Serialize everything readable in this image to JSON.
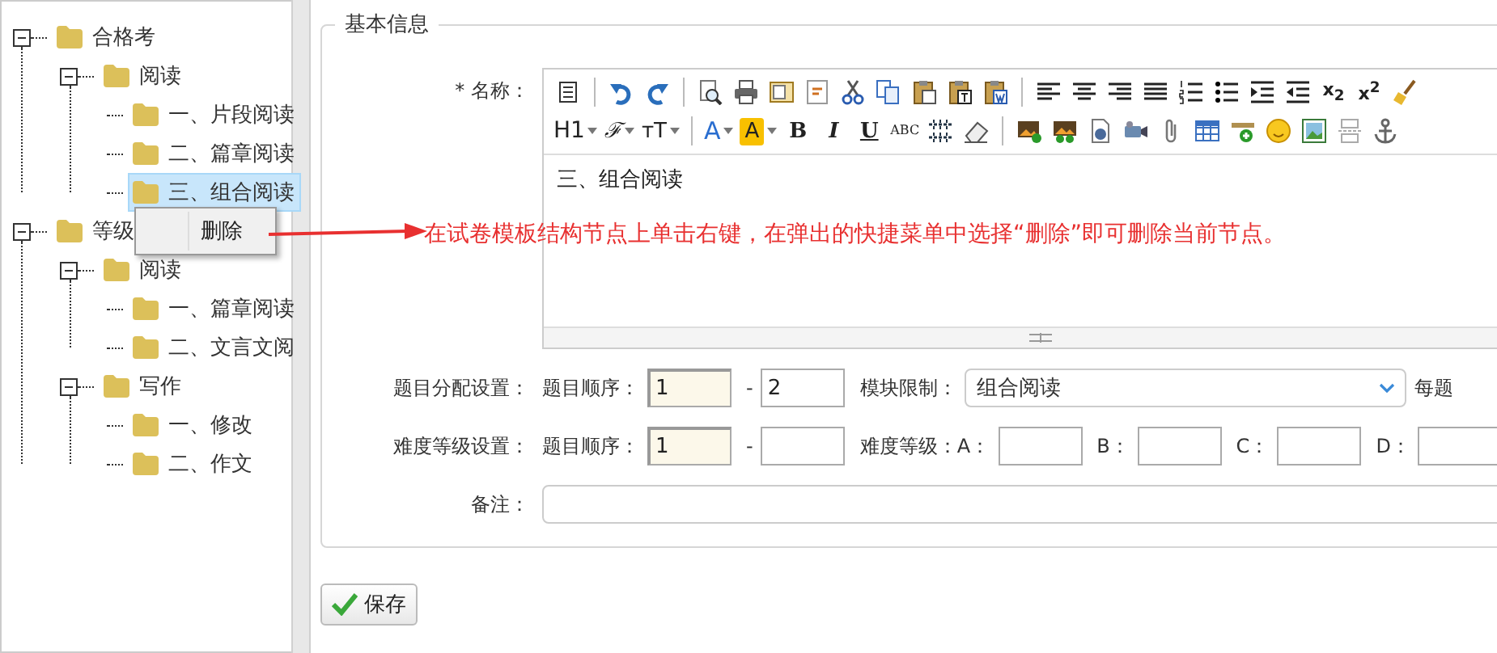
{
  "tree": [
    {
      "label": "合格考",
      "expanded": true,
      "selected": false,
      "children": [
        {
          "label": "阅读",
          "expanded": true,
          "selected": false,
          "children": [
            {
              "label": "一、片段阅读",
              "selected": false
            },
            {
              "label": "二、篇章阅读",
              "selected": false
            },
            {
              "label": "三、组合阅读",
              "selected": true
            }
          ]
        }
      ]
    },
    {
      "label": "等级",
      "expanded": true,
      "selected": false,
      "children": [
        {
          "label": "阅读",
          "expanded": true,
          "selected": false,
          "children": [
            {
              "label": "一、篇章阅读",
              "selected": false
            },
            {
              "label": "二、文言文阅",
              "selected": false
            }
          ]
        },
        {
          "label": "写作",
          "expanded": true,
          "selected": false,
          "children": [
            {
              "label": "一、修改",
              "selected": false
            },
            {
              "label": "二、作文",
              "selected": false
            }
          ]
        }
      ]
    }
  ],
  "context_menu": {
    "items": [
      "删除"
    ]
  },
  "annotation": "在试卷模板结构节点上单击右键，在弹出的快捷菜单中选择“删除”即可删除当前节点。",
  "form": {
    "legend": "基本信息",
    "name_label": "* 名称：",
    "toolbar": [
      [
        {
          "kind": "source"
        },
        {
          "kind": "separator"
        },
        {
          "kind": "undo"
        },
        {
          "kind": "redo"
        },
        {
          "kind": "separator"
        },
        {
          "kind": "preview"
        },
        {
          "kind": "print"
        },
        {
          "kind": "template"
        },
        {
          "kind": "code"
        },
        {
          "kind": "cut"
        },
        {
          "kind": "copy"
        },
        {
          "kind": "paste"
        },
        {
          "kind": "pastetext"
        },
        {
          "kind": "pasteword"
        },
        {
          "kind": "separator"
        },
        {
          "kind": "alignleft"
        },
        {
          "kind": "aligncenter"
        },
        {
          "kind": "alignright"
        },
        {
          "kind": "justify"
        },
        {
          "kind": "orderedlist"
        },
        {
          "kind": "unorderedlist"
        },
        {
          "kind": "indent"
        },
        {
          "kind": "outdent"
        },
        {
          "kind": "subscript",
          "label": "x$_{2}$"
        },
        {
          "kind": "superscript",
          "label": "x$^{2}$"
        },
        {
          "kind": "clearformat"
        }
      ],
      [
        {
          "kind": "heading",
          "label": "H1"
        },
        {
          "kind": "font",
          "label": "ℱ"
        },
        {
          "kind": "fontsize",
          "label": "ᴛT"
        },
        {
          "kind": "separator"
        },
        {
          "kind": "forecolor",
          "label": "A"
        },
        {
          "kind": "backcolor",
          "label": "A"
        },
        {
          "kind": "bold",
          "label": "B"
        },
        {
          "kind": "italic",
          "label": "I"
        },
        {
          "kind": "underline",
          "label": "U"
        },
        {
          "kind": "strike",
          "label": "ABC"
        },
        {
          "kind": "hr"
        },
        {
          "kind": "eraser"
        },
        {
          "kind": "separator"
        },
        {
          "kind": "image"
        },
        {
          "kind": "multiimage"
        },
        {
          "kind": "flash"
        },
        {
          "kind": "video"
        },
        {
          "kind": "attach"
        },
        {
          "kind": "table"
        },
        {
          "kind": "insertline"
        },
        {
          "kind": "emoticon"
        },
        {
          "kind": "picture"
        },
        {
          "kind": "pagebreak"
        },
        {
          "kind": "anchor"
        }
      ]
    ],
    "editor_content": "三、组合阅读",
    "rows": [
      {
        "label": "题目分配设置：",
        "items": [
          {
            "kind": "text",
            "text": "题目顺序："
          },
          {
            "kind": "input",
            "value": "1",
            "highlighted": true
          },
          {
            "kind": "text",
            "text": "-"
          },
          {
            "kind": "input",
            "value": "2",
            "highlighted": false
          },
          {
            "kind": "text",
            "text": "模块限制："
          },
          {
            "kind": "select",
            "value": "组合阅读"
          },
          {
            "kind": "text",
            "text": "每题"
          }
        ]
      },
      {
        "label": "难度等级设置：",
        "items": [
          {
            "kind": "text",
            "text": "题目顺序："
          },
          {
            "kind": "input",
            "value": "1",
            "highlighted": true
          },
          {
            "kind": "text",
            "text": "-"
          },
          {
            "kind": "input",
            "highlighted": false
          },
          {
            "kind": "text",
            "text": "难度等级：A："
          },
          {
            "kind": "input",
            "highlighted": false
          },
          {
            "kind": "text",
            "text": "B："
          },
          {
            "kind": "input",
            "highlighted": false
          },
          {
            "kind": "text",
            "text": "C："
          },
          {
            "kind": "input",
            "highlighted": false
          },
          {
            "kind": "text",
            "text": "D："
          },
          {
            "kind": "input",
            "highlighted": false
          }
        ]
      },
      {
        "label": "备注：",
        "items": [
          {
            "kind": "textarea"
          }
        ]
      }
    ]
  },
  "save_button": "保存"
}
